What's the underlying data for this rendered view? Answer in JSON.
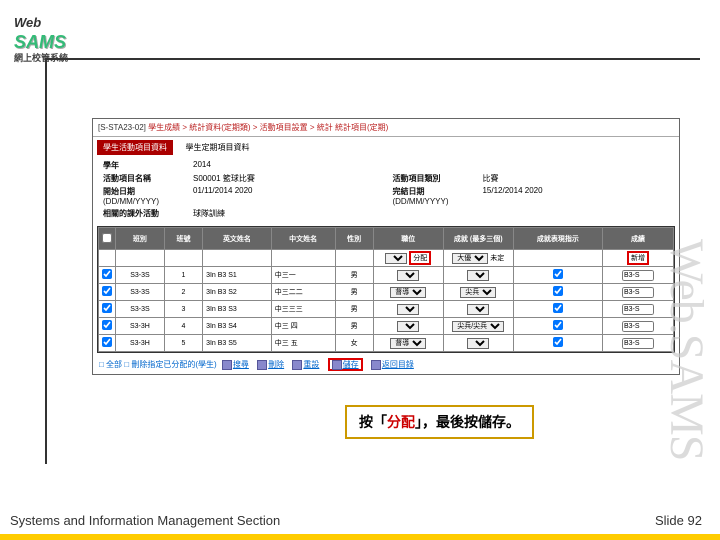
{
  "logo": {
    "top": "Web",
    "main": "SAMS",
    "sub": "網上校管系統"
  },
  "crumb": {
    "code": "[S-STA23-02]",
    "path": "學生成績 > 統計資料(定期類) > 活動項目設置 > 統計 統計項目(定期)"
  },
  "tabs": {
    "t1": "學生活動項目資料",
    "t2": "學生定期項目資料"
  },
  "detail": {
    "year_l": "學年",
    "year_v": "2014",
    "name_l": "活動項目名稱",
    "name_v": "S00001",
    "name_v2": "籃球比賽",
    "type_l": "活動項目類別",
    "type_v": "比賽",
    "start_l": "開始日期",
    "start_sub": "(DD/MM/YYYY)",
    "start_v": "01/11/2014",
    "start_v2": "2020",
    "end_l": "完結日期",
    "end_sub": "(DD/MM/YYYY)",
    "end_v": "15/12/2014",
    "end_v2": "2020",
    "related_l": "相關的課外活動",
    "related_v": "球隊訓練"
  },
  "grid": {
    "hdr": [
      "",
      "班別",
      "班號",
      "英文姓名",
      "中文姓名",
      "性別",
      "職位",
      "成就 (最多三個)",
      "成就表現指示",
      "成績"
    ],
    "filter": {
      "pos": "",
      "ach": "大優",
      "assign": "分配",
      "reset": "未定",
      "add": "新增"
    },
    "rows": [
      {
        "cls": "S3-3S",
        "no": "1",
        "en": "3In B3 S1",
        "zh": "中三一",
        "sex": "男",
        "pos": "",
        "ach": "",
        "ind": "B3-S",
        "cb": true
      },
      {
        "cls": "S3-3S",
        "no": "2",
        "en": "3In B3 S2",
        "zh": "中三二二",
        "sex": "男",
        "pos": "督導",
        "ach": "尖兵",
        "ind": "B3-S",
        "cb": true
      },
      {
        "cls": "S3-3S",
        "no": "3",
        "en": "3In B3 S3",
        "zh": "中三三三",
        "sex": "男",
        "pos": "",
        "ach": "",
        "ind": "B3-S",
        "cb": true
      },
      {
        "cls": "S3-3H",
        "no": "4",
        "en": "3In B3 S4",
        "zh": "中三  四",
        "sex": "男",
        "pos": "",
        "ach": "尖兵/尖兵",
        "ind": "B3-S",
        "cb": true
      },
      {
        "cls": "S3-3H",
        "no": "5",
        "en": "3In B3 S5",
        "zh": "中三  五",
        "sex": "女",
        "pos": "督導",
        "ach": "",
        "ind": "B3-S",
        "cb": true
      }
    ]
  },
  "btnbar": {
    "pageopt": "□ 全部 □ 刪除指定已分配的(學生)",
    "search": "搜尋",
    "del": "刪除",
    "reset": "重設",
    "save": "儲存",
    "back": "返回目錄"
  },
  "callout": {
    "pre": "按「",
    "kw": "分配",
    "post": "」，最後按儲存。"
  },
  "watermark": "Web.SAMS",
  "footer": {
    "left": "Systems and Information Management Section",
    "right_l": "Slide",
    "right_n": "92"
  }
}
